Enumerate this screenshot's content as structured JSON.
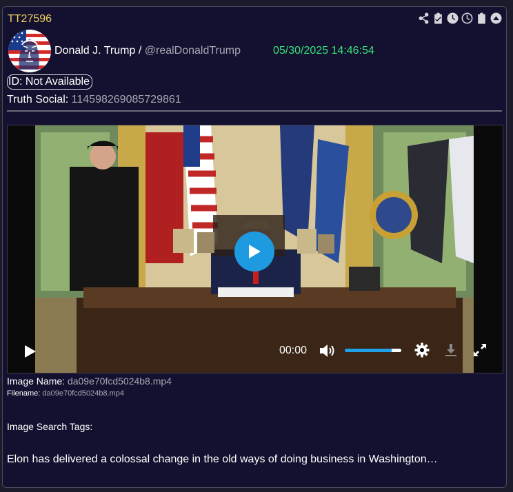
{
  "post": {
    "id": "TT27596",
    "author_name": "Donald J. Trump",
    "separator": "/",
    "handle": "@realDonaldTrump",
    "timestamp": "05/30/2025 14:46:54",
    "id_badge": "ID: Not Available",
    "truth_social_label": "Truth Social:",
    "truth_social_id": "114598269085729861",
    "text": "Elon has delivered a colossal change in the old ways of doing business in Washington…"
  },
  "toolbar": {
    "icons": [
      "share-icon",
      "clipboard-check-icon",
      "clock-icon",
      "clock-outline-icon",
      "clipboard-icon",
      "scroll-up-icon"
    ]
  },
  "video": {
    "time": "00:00",
    "volume": 0.83
  },
  "meta": {
    "image_name_label": "Image Name:",
    "image_name": "da09e70fcd5024b8.mp4",
    "filename_label": "Filename:",
    "filename": "da09e70fcd5024b8.mp4",
    "search_tags_label": "Image Search Tags:"
  },
  "colors": {
    "background": "#13112f",
    "accent_id": "#f4d35e",
    "timestamp": "#39e07a",
    "play_button": "#1e9ae0"
  }
}
